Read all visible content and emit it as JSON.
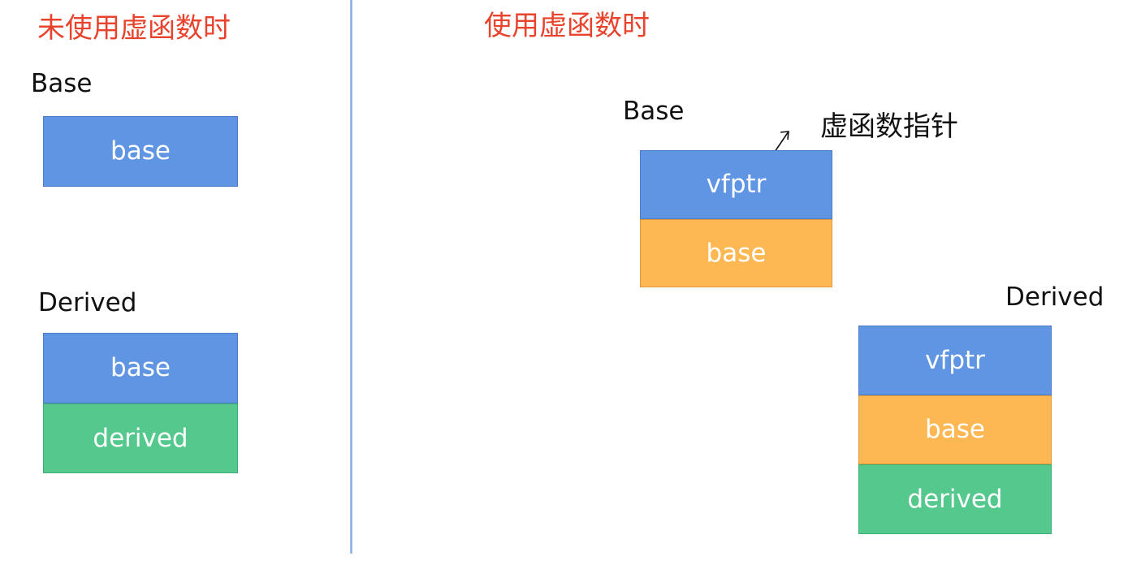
{
  "left": {
    "heading": "未使用虚函数时",
    "base_label": "Base",
    "base_block": "base",
    "derived_label": "Derived",
    "derived_blocks": [
      "base",
      "derived"
    ]
  },
  "right": {
    "heading": "使用虚函数时",
    "base_label": "Base",
    "pointer_label": "虚函数指针",
    "base_blocks": [
      "vfptr",
      "base"
    ],
    "derived_label": "Derived",
    "derived_blocks": [
      "vfptr",
      "base",
      "derived"
    ]
  },
  "colors": {
    "heading": "#e8432d",
    "blue": "#5f95e3",
    "orange": "#fdb753",
    "green": "#55c98d"
  }
}
